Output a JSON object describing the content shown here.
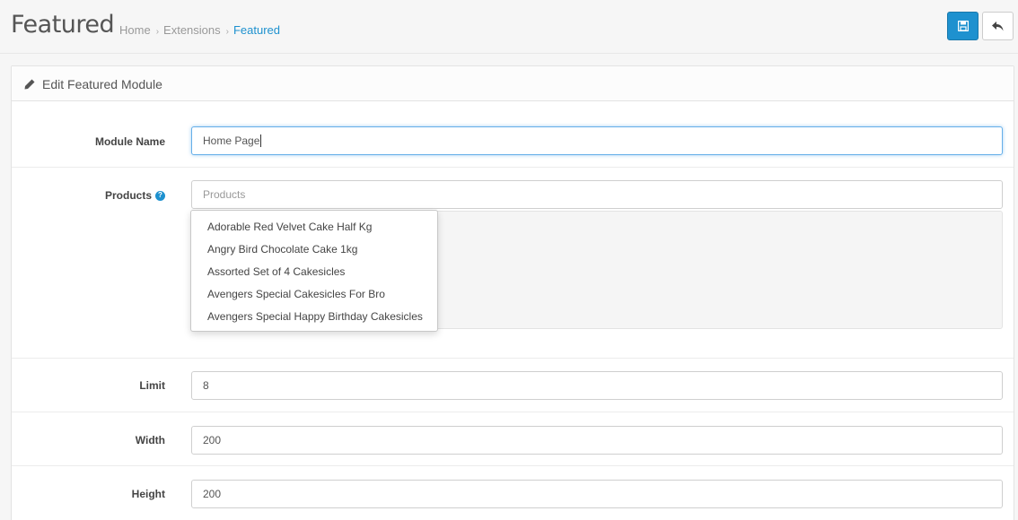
{
  "header": {
    "title": "Featured",
    "breadcrumb": [
      "Home",
      "Extensions",
      "Featured"
    ],
    "save_icon": "save-icon",
    "back_icon": "reply-icon"
  },
  "panel": {
    "title": "Edit Featured Module",
    "title_icon": "pencil-icon"
  },
  "form": {
    "module_name": {
      "label": "Module Name",
      "value": "Home Page"
    },
    "products": {
      "label": "Products",
      "placeholder": "Products",
      "help_icon": "question-circle-icon",
      "suggestions": [
        "Adorable Red Velvet Cake Half Kg",
        "Angry Bird Chocolate Cake 1kg",
        "Assorted Set of 4 Cakesicles",
        "Avengers Special Cakesicles For Bro",
        "Avengers Special Happy Birthday Cakesicles"
      ]
    },
    "limit": {
      "label": "Limit",
      "value": "8"
    },
    "width": {
      "label": "Width",
      "value": "200"
    },
    "height": {
      "label": "Height",
      "value": "200"
    }
  },
  "colors": {
    "accent": "#1e91cf",
    "focus_border": "#66afe9"
  }
}
